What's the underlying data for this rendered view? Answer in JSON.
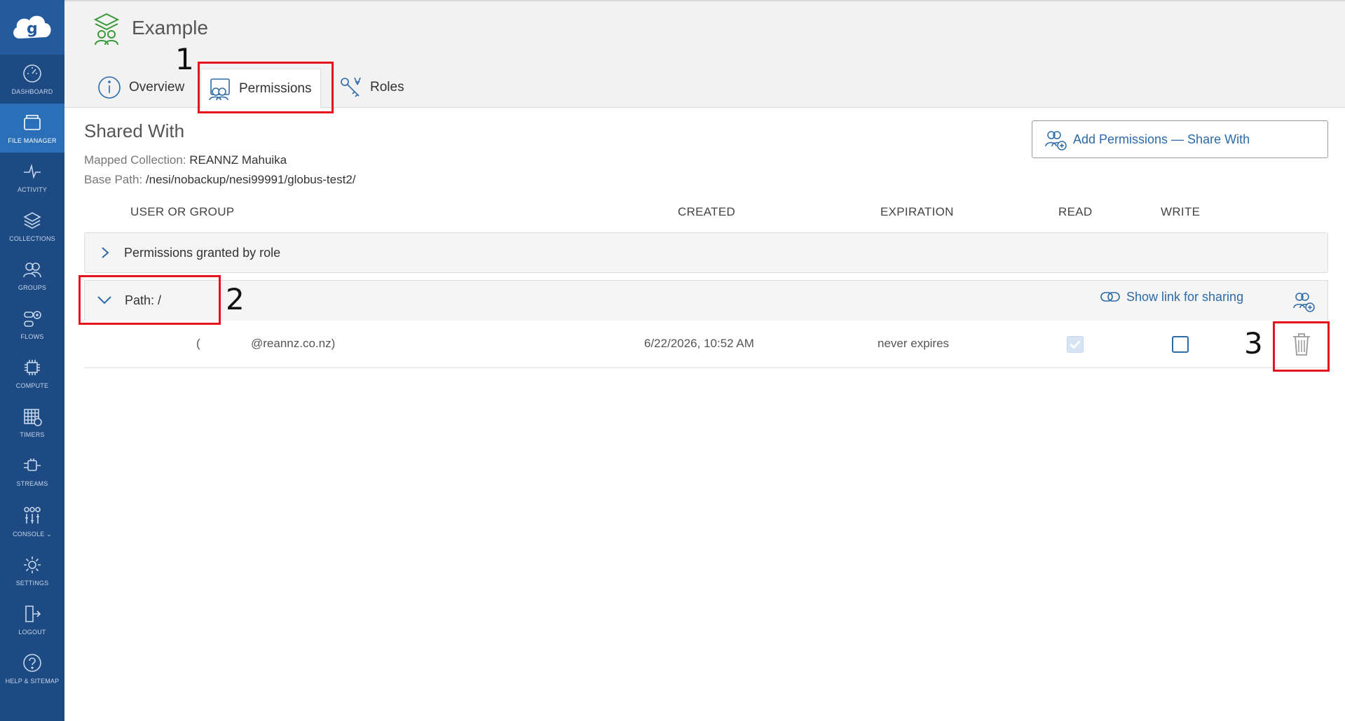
{
  "sidebar": {
    "items": [
      {
        "label": "DASHBOARD",
        "icon": "dashboard-icon"
      },
      {
        "label": "FILE MANAGER",
        "icon": "file-manager-icon",
        "active": true
      },
      {
        "label": "ACTIVITY",
        "icon": "activity-icon"
      },
      {
        "label": "COLLECTIONS",
        "icon": "collections-icon"
      },
      {
        "label": "GROUPS",
        "icon": "groups-icon"
      },
      {
        "label": "FLOWS",
        "icon": "flows-icon"
      },
      {
        "label": "COMPUTE",
        "icon": "compute-icon"
      },
      {
        "label": "TIMERS",
        "icon": "timers-icon"
      },
      {
        "label": "STREAMS",
        "icon": "streams-icon"
      },
      {
        "label": "CONSOLE ⌄",
        "icon": "console-icon"
      },
      {
        "label": "SETTINGS",
        "icon": "settings-icon"
      },
      {
        "label": "LOGOUT",
        "icon": "logout-icon"
      },
      {
        "label": "HELP & SITEMAP",
        "icon": "help-icon"
      }
    ]
  },
  "header": {
    "title": "Example",
    "tabs": [
      {
        "label": "Overview",
        "icon": "info-icon"
      },
      {
        "label": "Permissions",
        "icon": "permissions-icon",
        "active": true
      },
      {
        "label": "Roles",
        "icon": "roles-icon"
      }
    ]
  },
  "annotations": {
    "one": "1",
    "two": "2",
    "three": "3"
  },
  "main": {
    "section_title": "Shared With",
    "mapped_collection_key": "Mapped Collection:",
    "mapped_collection_value": "REANNZ Mahuika",
    "base_path_key": "Base Path:",
    "base_path_value": "/nesi/nobackup/nesi99991/globus-test2/",
    "add_permissions_label": "Add Permissions — Share With",
    "columns": {
      "user_or_group": "USER OR GROUP",
      "created": "CREATED",
      "expiration": "EXPIRATION",
      "read": "READ",
      "write": "WRITE"
    },
    "role_row_label": "Permissions granted by role",
    "path_row": {
      "label": "Path:  /",
      "share_link_label": "Show link for sharing"
    },
    "permission": {
      "user_paren": "(",
      "user_email": "@reannz.co.nz)",
      "created": "6/22/2026, 10:52 AM",
      "expiration": "never expires",
      "read": true,
      "write": false
    }
  },
  "colors": {
    "sidebar": "#1d4a82",
    "sidebar_active": "#2a6fb8",
    "accent": "#2c6aa8",
    "annotation": "#e8121b"
  }
}
